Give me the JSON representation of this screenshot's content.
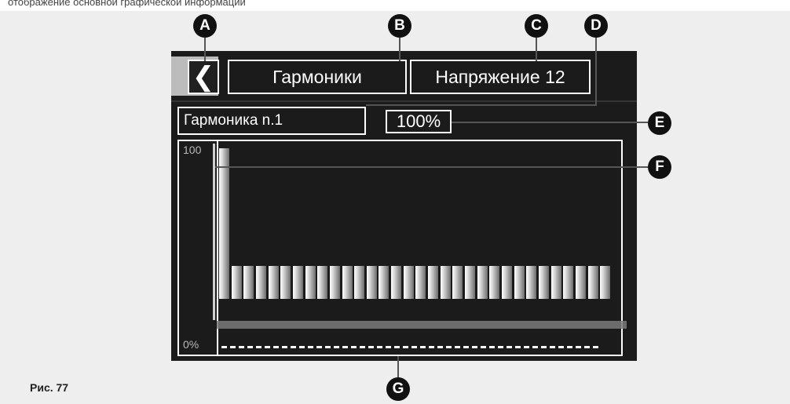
{
  "caption_top": "отображение основной графической информации",
  "figure_label": "Рис. 77",
  "header": {
    "back_symbol": "❮",
    "tab_harmonics": "Гармоники",
    "tab_voltage": "Напряжение 12"
  },
  "selected": {
    "harmonic_name": "Гармоника n.1",
    "harmonic_value": "100%"
  },
  "callouts": [
    "A",
    "B",
    "C",
    "D",
    "E",
    "F",
    "G"
  ],
  "colors": {
    "screen_bg": "#1b1b1b",
    "panel_bg": "#eeeeee",
    "badge": "#111111"
  },
  "chart_data": {
    "type": "bar",
    "ytick_top": "100",
    "ytick_bottom": "0%",
    "ylim": [
      0,
      100
    ],
    "values": [
      100,
      22,
      22,
      22,
      22,
      22,
      22,
      22,
      22,
      22,
      22,
      22,
      22,
      22,
      22,
      22,
      22,
      22,
      22,
      22,
      22,
      22,
      22,
      22,
      22,
      22,
      22,
      22,
      22,
      22,
      22,
      22
    ]
  }
}
